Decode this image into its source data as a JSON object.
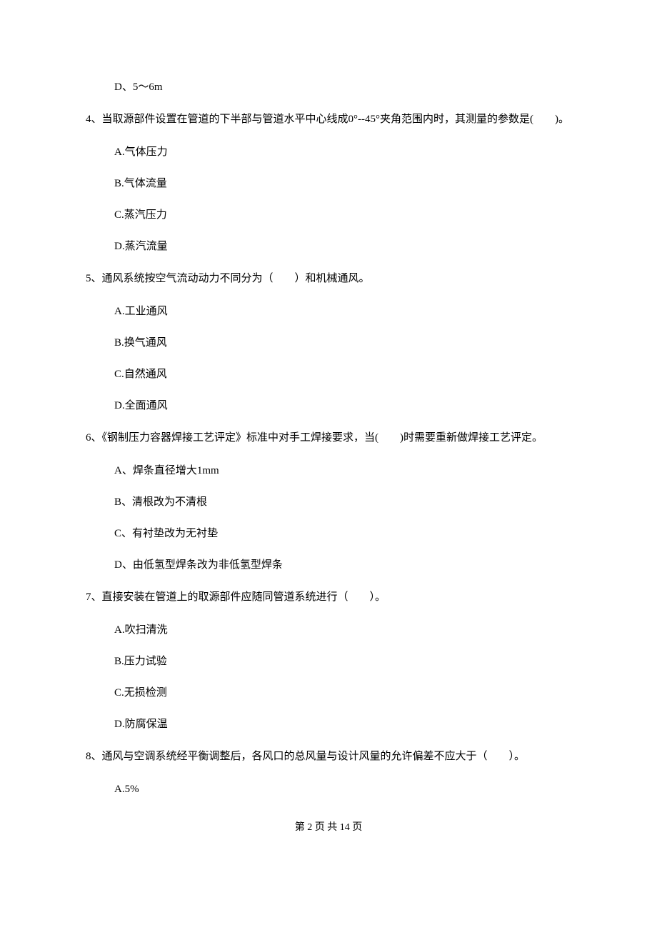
{
  "q3_optD": "D、5～6m",
  "q4_stem": "4、当取源部件设置在管道的下半部与管道水平中心线成0°--45°夹角范围内时，其测量的参数是(　　)。",
  "q4_A": "A.气体压力",
  "q4_B": "B.气体流量",
  "q4_C": "C.蒸汽压力",
  "q4_D": "D.蒸汽流量",
  "q5_stem": "5、通风系统按空气流动动力不同分为（　　）和机械通风。",
  "q5_A": "A.工业通风",
  "q5_B": "B.换气通风",
  "q5_C": "C.自然通风",
  "q5_D": "D.全面通风",
  "q6_stem": "6、《钢制压力容器焊接工艺评定》标准中对手工焊接要求，当(　　)时需要重新做焊接工艺评定。",
  "q6_A": "A、焊条直径增大1mm",
  "q6_B": "B、清根改为不清根",
  "q6_C": "C、有衬垫改为无衬垫",
  "q6_D": "D、由低氢型焊条改为非低氢型焊条",
  "q7_stem": "7、直接安装在管道上的取源部件应随同管道系统进行（　　）。",
  "q7_A": "A.吹扫清洗",
  "q7_B": "B.压力试验",
  "q7_C": "C.无损检测",
  "q7_D": "D.防腐保温",
  "q8_stem": "8、通风与空调系统经平衡调整后，各风口的总风量与设计风量的允许偏差不应大于（　　）。",
  "q8_A": "A.5%",
  "footer": "第 2 页 共 14 页"
}
